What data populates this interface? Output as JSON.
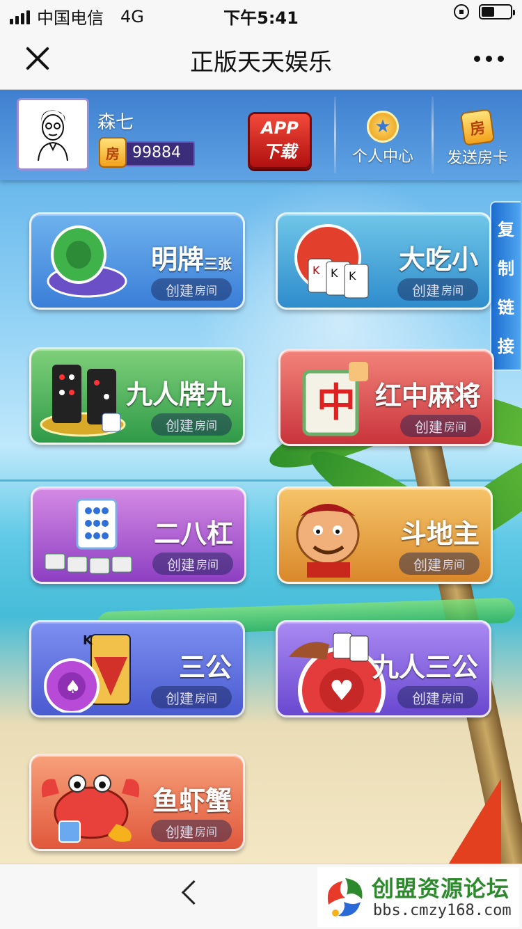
{
  "status_bar": {
    "carrier": "中国电信",
    "network": "4G",
    "time": "下午5:41"
  },
  "nav": {
    "title": "正版天天娱乐"
  },
  "user": {
    "name": "森七",
    "card_icon_text": "房",
    "card_count": "99884"
  },
  "header": {
    "app_download_line1": "APP",
    "app_download_line2": "下载",
    "personal_center": "个人中心",
    "send_room_card": "发送房卡",
    "room_card_icon_text": "房"
  },
  "copy_link": {
    "chars": [
      "复",
      "制",
      "链",
      "接"
    ]
  },
  "create_room": {
    "main": "创建",
    "small": "房间"
  },
  "games": [
    {
      "name": "明牌",
      "suffix": "三张",
      "color": "blue"
    },
    {
      "name": "大吃小",
      "suffix": "",
      "color": "teal"
    },
    {
      "name": "九人牌九",
      "suffix": "",
      "color": "green"
    },
    {
      "name": "红中麻将",
      "suffix": "",
      "color": "red"
    },
    {
      "name": "二八杠",
      "suffix": "",
      "color": "purple"
    },
    {
      "name": "斗地主",
      "suffix": "",
      "color": "orange"
    },
    {
      "name": "三公",
      "suffix": "",
      "color": "royal"
    },
    {
      "name": "九人三公",
      "suffix": "",
      "color": "violet"
    },
    {
      "name": "鱼虾蟹",
      "suffix": "",
      "color": "coral"
    }
  ],
  "watermark": {
    "title": "创盟资源论坛",
    "url": "bbs.cmzy168.com"
  },
  "icons": {
    "close": "close-icon",
    "more": "more-icon",
    "back": "back-icon",
    "medal": "medal-icon",
    "room_card": "room-card-icon"
  }
}
